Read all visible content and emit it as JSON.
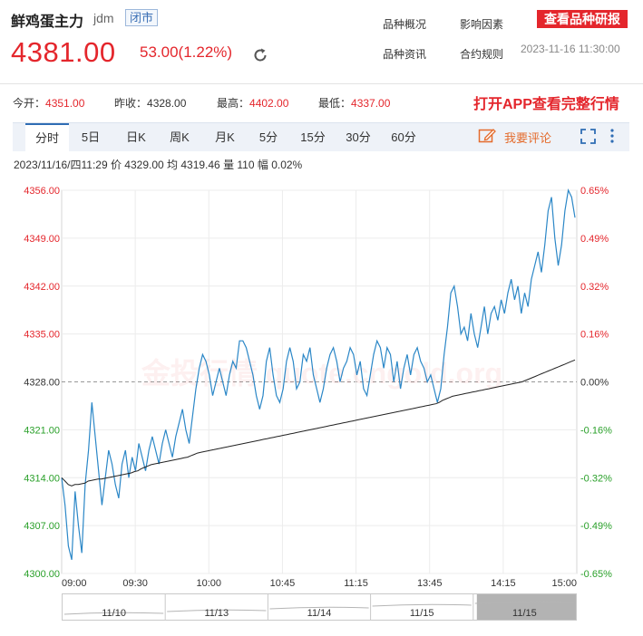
{
  "header": {
    "name": "鲜鸡蛋主力",
    "code": "jdm",
    "status": "闭市",
    "price": "4381.00",
    "change": "53.00(1.22%)",
    "links": [
      "品种概况",
      "影响因素",
      "品种资讯",
      "合约规则"
    ],
    "research_button": "查看品种研报",
    "datetime": "2023-11-16 11:30:00"
  },
  "stats": [
    {
      "label": "今开：",
      "value": "4351.00",
      "color": "#e4262c"
    },
    {
      "label": "昨收：",
      "value": "4328.00",
      "color": "#333333"
    },
    {
      "label": "最高：",
      "value": "4402.00",
      "color": "#e4262c"
    },
    {
      "label": "最低：",
      "value": "4337.00",
      "color": "#e4262c"
    }
  ],
  "app_banner": "打开APP查看完整行情",
  "tabs": [
    "分时",
    "5日",
    "日K",
    "周K",
    "月K",
    "5分",
    "15分",
    "30分",
    "60分"
  ],
  "active_tab": 0,
  "comment_label": "我要评论",
  "info_line": "2023/11/16/四11:29  价 4329.00  均 4319.46  量 110  幅 0.02%",
  "watermark": "金投行情 quote.cngold.org",
  "colors": {
    "up": "#e4262c",
    "down": "#2aa02a",
    "price_line": "#2b87c7",
    "avg_line": "#222222",
    "accent": "#2f6db4"
  },
  "chart_data": {
    "type": "line",
    "title": "",
    "xlabel": "",
    "ylabel": "",
    "prev_close": 4328.0,
    "ylim": [
      4300,
      4356
    ],
    "y_ticks": [
      "4356.00",
      "4349.00",
      "4342.00",
      "4335.00",
      "4328.00",
      "4321.00",
      "4314.00",
      "4307.00",
      "4300.00"
    ],
    "y_ticks_right": [
      "0.65%",
      "0.49%",
      "0.32%",
      "0.16%",
      "0.00%",
      "-0.16%",
      "-0.32%",
      "-0.49%",
      "-0.65%"
    ],
    "x_ticks": [
      "09:00",
      "09:30",
      "10:00",
      "10:45",
      "11:15",
      "13:45",
      "14:15",
      "15:00"
    ],
    "grid": true,
    "series": [
      {
        "values": [
          4314,
          4310,
          4304,
          4302,
          4312,
          4307,
          4303,
          4313,
          4318,
          4325,
          4320,
          4315,
          4310,
          4314,
          4318,
          4316,
          4313,
          4311,
          4316,
          4318,
          4314,
          4317,
          4315,
          4319,
          4317,
          4315,
          4318,
          4320,
          4318,
          4316,
          4319,
          4321,
          4319,
          4317,
          4320,
          4322,
          4324,
          4321,
          4319,
          4323,
          4327,
          4330,
          4332,
          4331,
          4329,
          4326,
          4328,
          4330,
          4328,
          4326,
          4329,
          4331,
          4330,
          4334,
          4334,
          4333,
          4331,
          4329,
          4326,
          4324,
          4326,
          4331,
          4333,
          4329,
          4326,
          4325,
          4327,
          4331,
          4333,
          4331,
          4327,
          4328,
          4332,
          4331,
          4333,
          4329,
          4327,
          4325,
          4327,
          4330,
          4332,
          4333,
          4331,
          4328,
          4330,
          4331,
          4333,
          4332,
          4329,
          4331,
          4327,
          4326,
          4329,
          4332,
          4334,
          4333,
          4330,
          4333,
          4332,
          4328,
          4331,
          4327,
          4330,
          4332,
          4329,
          4332,
          4333,
          4331,
          4330,
          4328,
          4329,
          4327,
          4325,
          4327,
          4332,
          4336,
          4341,
          4342,
          4339,
          4335,
          4336,
          4334,
          4338,
          4335,
          4333,
          4336,
          4339,
          4335,
          4338,
          4339,
          4337,
          4340,
          4338,
          4341,
          4343,
          4340,
          4342,
          4338,
          4341,
          4339,
          4343,
          4345,
          4347,
          4344,
          4348,
          4353,
          4355,
          4349,
          4345,
          4348,
          4353,
          4356,
          4355,
          4352
        ]
      },
      {
        "name": "均",
        "values": [
          4314,
          4313.5,
          4313,
          4312.8,
          4313,
          4313,
          4313.1,
          4313.2,
          4313.5,
          4313.6,
          4313.7,
          4313.8,
          4313.8,
          4313.9,
          4314,
          4314.1,
          4314.2,
          4314.3,
          4314.4,
          4314.5,
          4314.6,
          4314.7,
          4314.9,
          4315,
          4315.3,
          4315.5,
          4315.7,
          4315.9,
          4316,
          4316.1,
          4316.2,
          4316.3,
          4316.4,
          4316.5,
          4316.6,
          4316.7,
          4316.8,
          4316.9,
          4317,
          4317.2,
          4317.4,
          4317.6,
          4317.7,
          4317.8,
          4317.9,
          4318,
          4318.1,
          4318.2,
          4318.3,
          4318.4,
          4318.5,
          4318.6,
          4318.7,
          4318.8,
          4318.9,
          4319,
          4319.1,
          4319.2,
          4319.3,
          4319.4,
          4319.5,
          4319.6,
          4319.7,
          4319.8,
          4319.9,
          4320,
          4320.1,
          4320.2,
          4320.3,
          4320.4,
          4320.5,
          4320.6,
          4320.7,
          4320.8,
          4320.9,
          4321,
          4321.1,
          4321.2,
          4321.3,
          4321.4,
          4321.5,
          4321.6,
          4321.7,
          4321.8,
          4321.9,
          4322,
          4322.1,
          4322.2,
          4322.3,
          4322.4,
          4322.5,
          4322.6,
          4322.7,
          4322.8,
          4322.9,
          4323,
          4323.1,
          4323.2,
          4323.3,
          4323.4,
          4323.5,
          4323.6,
          4323.7,
          4323.8,
          4323.9,
          4324,
          4324.1,
          4324.2,
          4324.3,
          4324.4,
          4324.5,
          4324.6,
          4324.7,
          4324.8,
          4325,
          4325.3,
          4325.5,
          4325.7,
          4325.9,
          4326,
          4326.1,
          4326.2,
          4326.3,
          4326.4,
          4326.5,
          4326.6,
          4326.7,
          4326.8,
          4326.9,
          4327,
          4327.1,
          4327.2,
          4327.3,
          4327.4,
          4327.5,
          4327.6,
          4327.7,
          4327.8,
          4327.9,
          4328,
          4328.2,
          4328.4,
          4328.6,
          4328.8,
          4329,
          4329.2,
          4329.4,
          4329.6,
          4329.8,
          4330,
          4330.2,
          4330.4,
          4330.6,
          4330.8,
          4331,
          4331.2
        ]
      }
    ],
    "navigator_labels": [
      "11/10",
      "11/13",
      "11/14",
      "11/15",
      "11/15"
    ]
  }
}
